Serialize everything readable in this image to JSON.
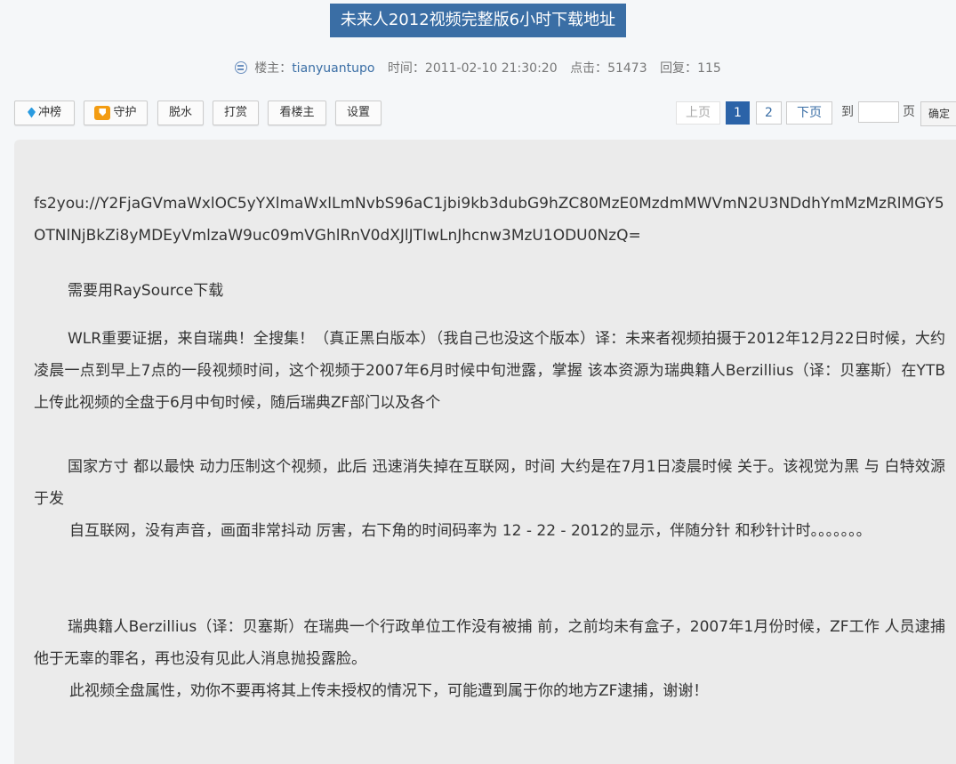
{
  "title": "未来人2012视频完整版6小时下载地址",
  "meta": {
    "author_label": "楼主：",
    "author": "tianyuantupo",
    "time_label": "时间：",
    "time": "2011-02-10 21:30:20",
    "views_label": "点击：",
    "views": "51473",
    "replies_label": "回复：",
    "replies": "115"
  },
  "toolbar": {
    "rank": "冲榜",
    "guard": "守护",
    "dehydrate": "脱水",
    "reward": "打赏",
    "only_op": "看楼主",
    "settings": "设置"
  },
  "pager": {
    "prev": "上页",
    "pages": [
      "1",
      "2"
    ],
    "current_page": "1",
    "next": "下页",
    "goto_label": "到",
    "page_unit": "页",
    "goto_value": "",
    "confirm": "确定"
  },
  "colors": {
    "title_bg": "#3a6ea5",
    "current_page_bg": "#2b63a8",
    "content_bg": "#ebebeb",
    "accent_link": "#3a6ea5"
  },
  "icons": {
    "author": "smile-face-icon",
    "rank": "diamond-icon",
    "guard": "shield-icon"
  },
  "post": {
    "link": "fs2you://Y2FjaGVmaWxlOC5yYXlmaWxlLmNvbS96aC1jbi9kb3dubG9hZC80MzE0MzdmMWVmN2U3NDdhYmMzMzRlMGY5OTNlNjBkZi8yMDEyVmlzaW9uc09mVGhlRnV0dXJlJTIwLnJhcnw3MzU1ODU0NzQ=",
    "p1": "需要用RaySource下载",
    "p2": "WLR重要证据，来自瑞典！全搜集！（真正黑白版本）（我自己也没这个版本）译：未来者视频拍摄于2012年12月22日时候，大约凌晨一点到早上7点的一段视频时间，这个视频于2007年6月时候中旬泄露，掌握 该本资源为瑞典籍人Berzillius（译：贝塞斯）在YTB上传此视频的全盘于6月中旬时候，随后瑞典ZF部门以及各个",
    "p3": "国家方寸 都以最快 动力压制这个视频，此后 迅速消失掉在互联网，时间 大约是在7月1日凌晨时候 关于。该视觉为黑 与 白特效源于发",
    "p4": "自互联网，没有声音，画面非常抖动 厉害，右下角的时间码率为 12 - 22 - 2012的显示，伴随分针 和秒针计时。。。。。。。",
    "p5": "瑞典籍人Berzillius（译：贝塞斯）在瑞典一个行政单位工作没有被捕 前，之前均未有盒子，2007年1月份时候，ZF工作 人员逮捕他于无辜的罪名，再也没有见此人消息抛投露脸。",
    "p6": "此视频全盘属性，劝你不要再将其上传未授权的情况下，可能遭到属于你的地方ZF逮捕，谢谢！"
  }
}
